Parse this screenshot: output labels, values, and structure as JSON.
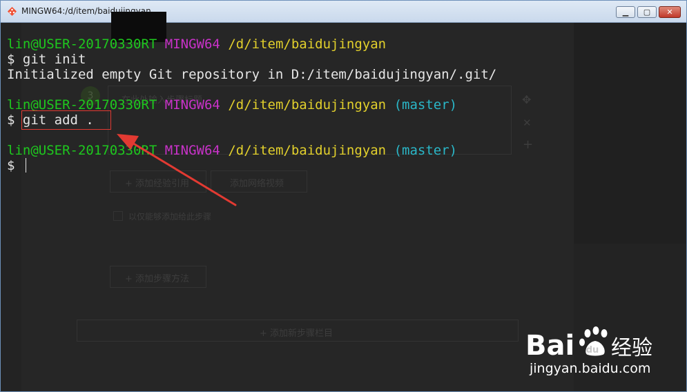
{
  "window": {
    "title": "MINGW64:/d/item/baidujingyan",
    "minimize_label": "▁",
    "maximize_label": "▢",
    "close_label": "✕"
  },
  "background_page": {
    "input_placeholder": "在此处输入步骤标题",
    "add_tip": "+ 添加经验引用",
    "add_video": "添加网络视频",
    "checkbox_label": "以仅能够添加给此步骤",
    "add_method": "+ 添加步骤方法",
    "add_section": "+ 添加新步骤栏目",
    "move_icon": "✥",
    "delete_icon": "✕",
    "plus_icon": "+",
    "step_number": "3"
  },
  "terminal": {
    "prompt1": {
      "user": "lin@USER-20170330RT",
      "shell": "MINGW64",
      "path": "/d/item/baidujingyan",
      "branch": ""
    },
    "cmd1": "$ git init",
    "out1": "Initialized empty Git repository in D:/item/baidujingyan/.git/",
    "prompt2": {
      "user": "lin@USER-20170330RT",
      "shell": "MINGW64",
      "path": "/d/item/baidujingyan",
      "branch": "(master)"
    },
    "cmd2_prefix": "$ ",
    "cmd2": "git add .",
    "prompt3": {
      "user": "lin@USER-20170330RT",
      "shell": "MINGW64",
      "path": "/d/item/baidujingyan",
      "branch": "(master)"
    },
    "cmd3_prefix": "$ "
  },
  "colors": {
    "user": "#1ec81e",
    "shell": "#c832c8",
    "path": "#e2d02c",
    "branch": "#2ab7c8",
    "annotation": "#e23a32"
  },
  "watermark": {
    "logo_text": "Bai",
    "logo_suffix": "经验",
    "url": "jingyan.baidu.com"
  }
}
